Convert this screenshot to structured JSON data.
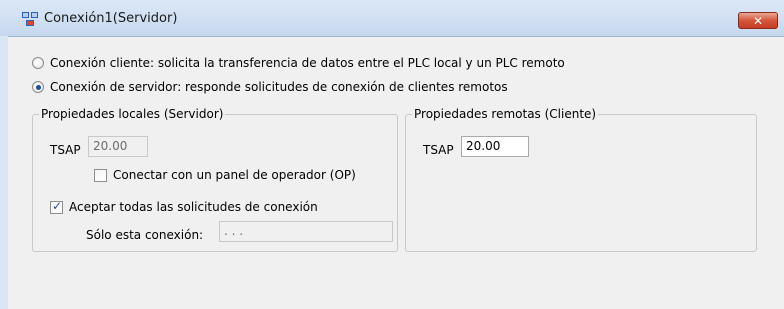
{
  "window": {
    "title": "Conexión1(Servidor)",
    "close_label": "✕"
  },
  "options": {
    "client": "Conexión cliente: solicita la transferencia de datos entre el PLC local y un PLC remoto",
    "server": "Conexión de servidor: responde solicitudes de conexión de clientes remotos",
    "selected": "server"
  },
  "local": {
    "legend": "Propiedades locales (Servidor)",
    "tsap_label": "TSAP",
    "tsap_value": "20.00",
    "op_label": "Conectar con un panel de operador (OP)",
    "op_checked": false,
    "accept_label": "Aceptar todas las solicitudes de conexión",
    "accept_checked": true,
    "only_label": "Sólo esta conexión:",
    "only_value": ".   .   ."
  },
  "remote": {
    "legend": "Propiedades remotas (Cliente)",
    "tsap_label": "TSAP",
    "tsap_value": "20.00"
  },
  "colors": {
    "titlebar": "#c6d8ef",
    "close": "#d4553a",
    "panel": "#f0f0f0"
  }
}
